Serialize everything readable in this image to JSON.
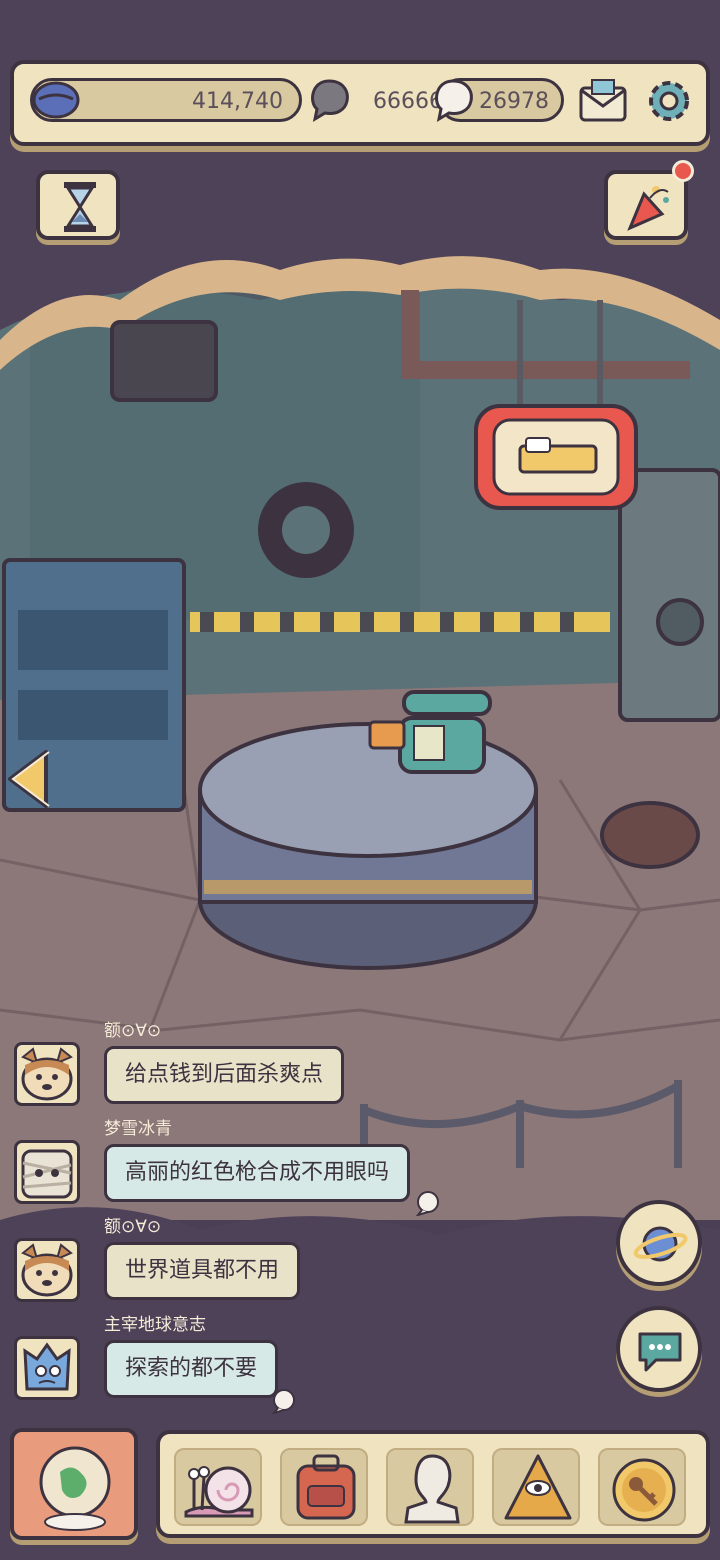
{
  "currency": {
    "coins": "414,740",
    "gray_gems": "66666",
    "white_gems": "26978"
  },
  "icons": {
    "coin": "purple-coin-icon",
    "gray_gem": "gray-speech-gem-icon",
    "white_gem": "white-speech-gem-icon",
    "mail": "mail-icon",
    "settings": "gear-icon",
    "timer": "hourglass-icon",
    "events": "party-popper-icon",
    "bed_sign": "bed-sign",
    "phone": "rotary-phone",
    "prev": "left-arrow-icon",
    "planet": "planet-icon",
    "chat": "chat-icon"
  },
  "chat": [
    {
      "user": "额⊙∀⊙",
      "message": "给点钱到后面杀爽点",
      "bubble": "#e8e2c8",
      "avatar": "dog-avatar"
    },
    {
      "user": "梦雪冰青",
      "message": "高丽的红色枪合成不用眼吗",
      "bubble": "#d6e9e6",
      "avatar": "mummy-avatar"
    },
    {
      "user": "额⊙∀⊙",
      "message": "世界道具都不用",
      "bubble": "#e8e2c8",
      "avatar": "dog-avatar"
    },
    {
      "user": "主宰地球意志",
      "message": "探索的都不要",
      "bubble": "#d6e9e6",
      "avatar": "blue-creature-avatar"
    }
  ],
  "bottom_nav": [
    {
      "name": "snail-icon"
    },
    {
      "name": "backpack-icon"
    },
    {
      "name": "statue-icon"
    },
    {
      "name": "pyramid-eye-icon"
    },
    {
      "name": "key-coin-icon"
    }
  ],
  "colors": {
    "panel": "#efe3c0",
    "outline": "#3d3340",
    "notification": "#e8584f"
  }
}
